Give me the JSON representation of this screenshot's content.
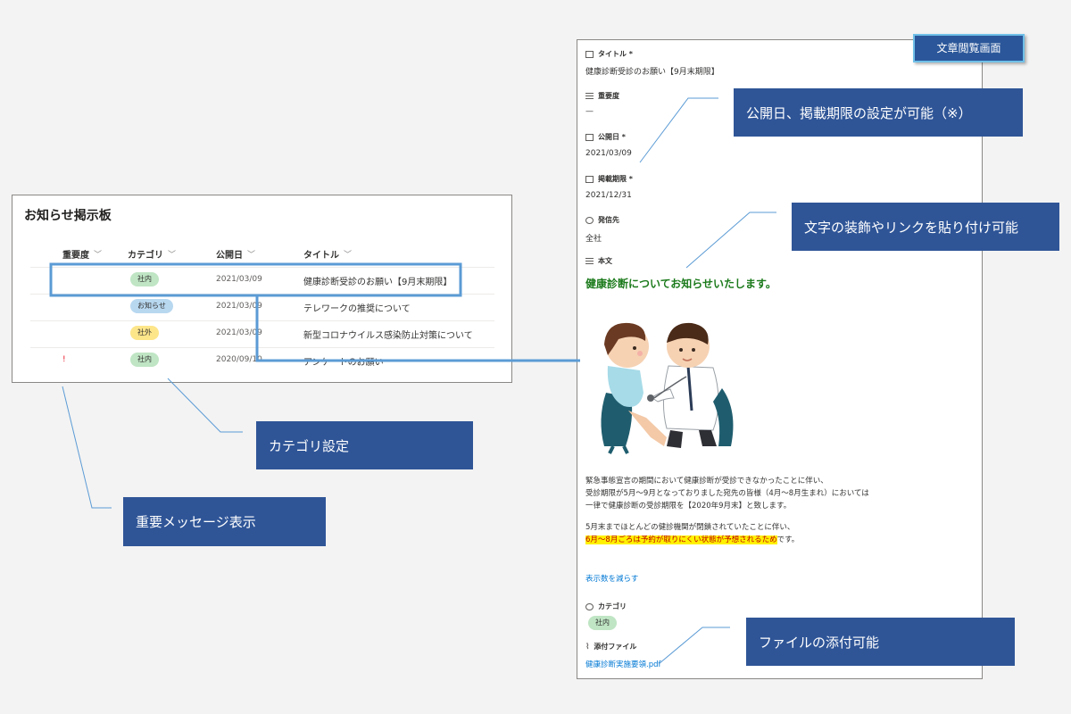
{
  "list": {
    "title": "お知らせ掲示板",
    "columns": [
      "重要度",
      "カテゴリ",
      "公開日",
      "タイトル"
    ],
    "rows": [
      {
        "importance": "",
        "category": "社内",
        "category_color": "#bfe5c4",
        "date": "2021/03/09",
        "title": "健康診断受診のお願い【9月末期限】"
      },
      {
        "importance": "",
        "category": "お知らせ",
        "category_color": "#b8d8f0",
        "date": "2021/03/09",
        "title": "テレワークの推奨について"
      },
      {
        "importance": "",
        "category": "社外",
        "category_color": "#fde58a",
        "date": "2021/03/09",
        "title": "新型コロナウイルス感染防止対策について"
      },
      {
        "importance": "!",
        "category": "社内",
        "category_color": "#bfe5c4",
        "date": "2020/09/10",
        "title": "アンケートのお願い"
      }
    ]
  },
  "detail": {
    "view_tag": "文章閲覧画面",
    "title_label": "タイトル *",
    "title_value": "健康診断受診のお願い【9月末期限】",
    "importance_label": "重要度",
    "importance_value": "—",
    "publish_label": "公開日 *",
    "publish_value": "2021/03/09",
    "expiry_label": "掲載期限 *",
    "expiry_value": "2021/12/31",
    "sender_label": "発信先",
    "sender_value": "全社",
    "body_label": "本文",
    "body_heading": "健康診断についてお知らせいたします。",
    "body_lines": [
      "緊急事態宣言の期間において健康診断が受診できなかったことに伴い、",
      "受診期限が5月～9月となっておりました宛先の皆様（4月～8月生まれ）においては",
      "一律で健康診断の受診期限を【2020年9月末】と致します。",
      "5月末までほとんどの健診機関が閉鎖されていたことに伴い、"
    ],
    "body_highlight": "6月～8月ごろは予約が取りにくい状態が予想されるため",
    "body_highlight_suffix": "です。",
    "show_less": "表示数を減らす",
    "category_label": "カテゴリ",
    "category_value": "社内",
    "attachment_label": "添付ファイル",
    "attachment_value": "健康診断実施要領.pdf"
  },
  "callouts": {
    "dates": "公開日、掲載期限の設定が可能（※）",
    "decoration": "文字の装飾やリンクを貼り付け可能",
    "category": "カテゴリ設定",
    "important": "重要メッセージ表示",
    "attachment": "ファイルの添付可能"
  },
  "colors": {
    "callout_bg": "#2f5597",
    "highlight_box": "#5b9bd5",
    "heading_green": "#1b7a1b",
    "link_blue": "#0078d4"
  }
}
